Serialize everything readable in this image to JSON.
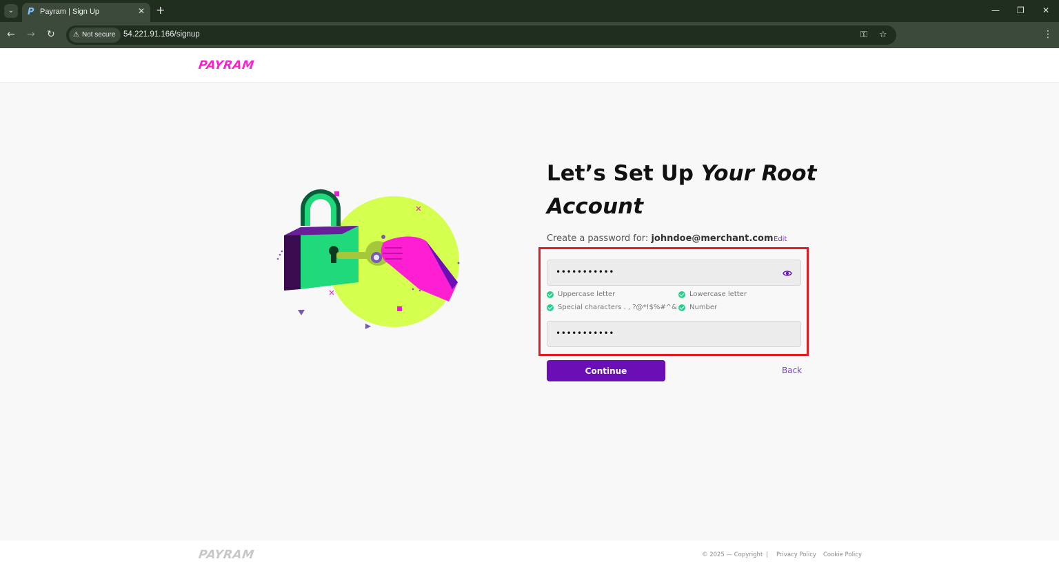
{
  "browser": {
    "tab_title": "Payram | Sign Up",
    "tab_favicon": "P",
    "close_tab_glyph": "✕",
    "new_tab_glyph": "+",
    "security_label": "Not secure",
    "url": "54.221.91.166/signup",
    "window_controls": [
      "minimize-icon",
      "restore-icon",
      "close-icon"
    ],
    "toolbar_icons": [
      "back-arrow-icon",
      "forward-arrow-icon",
      "reload-icon",
      "password-key-icon",
      "bookmark-star-icon",
      "kebab-menu-icon"
    ]
  },
  "header": {
    "logo": "PAYRAM"
  },
  "main": {
    "headline_regular": "Let’s Set Up ",
    "headline_bold": "Your Root Account",
    "create_prefix": "Create a password for: ",
    "email": "johndoe@merchant.com",
    "edit_label": "Edit",
    "password_value": "•••••••••••",
    "confirm_value": "•••••••••••",
    "requirements": [
      "Uppercase letter",
      "Lowercase letter",
      "Special characters . , ?@*!$%#^&",
      "Number"
    ],
    "continue_label": "Continue",
    "back_label": "Back"
  },
  "footer": {
    "logo": "PAYRAM",
    "copyright": "© 2025 — Copyright",
    "separator": "|",
    "privacy": "Privacy Policy",
    "cookie": "Cookie Policy"
  },
  "colors": {
    "brand_magenta": "#ff1fd2",
    "primary_purple": "#6a0fb5",
    "highlight_red": "#e01b24",
    "check_green": "#23d18b",
    "lime": "#d4ff4f"
  }
}
